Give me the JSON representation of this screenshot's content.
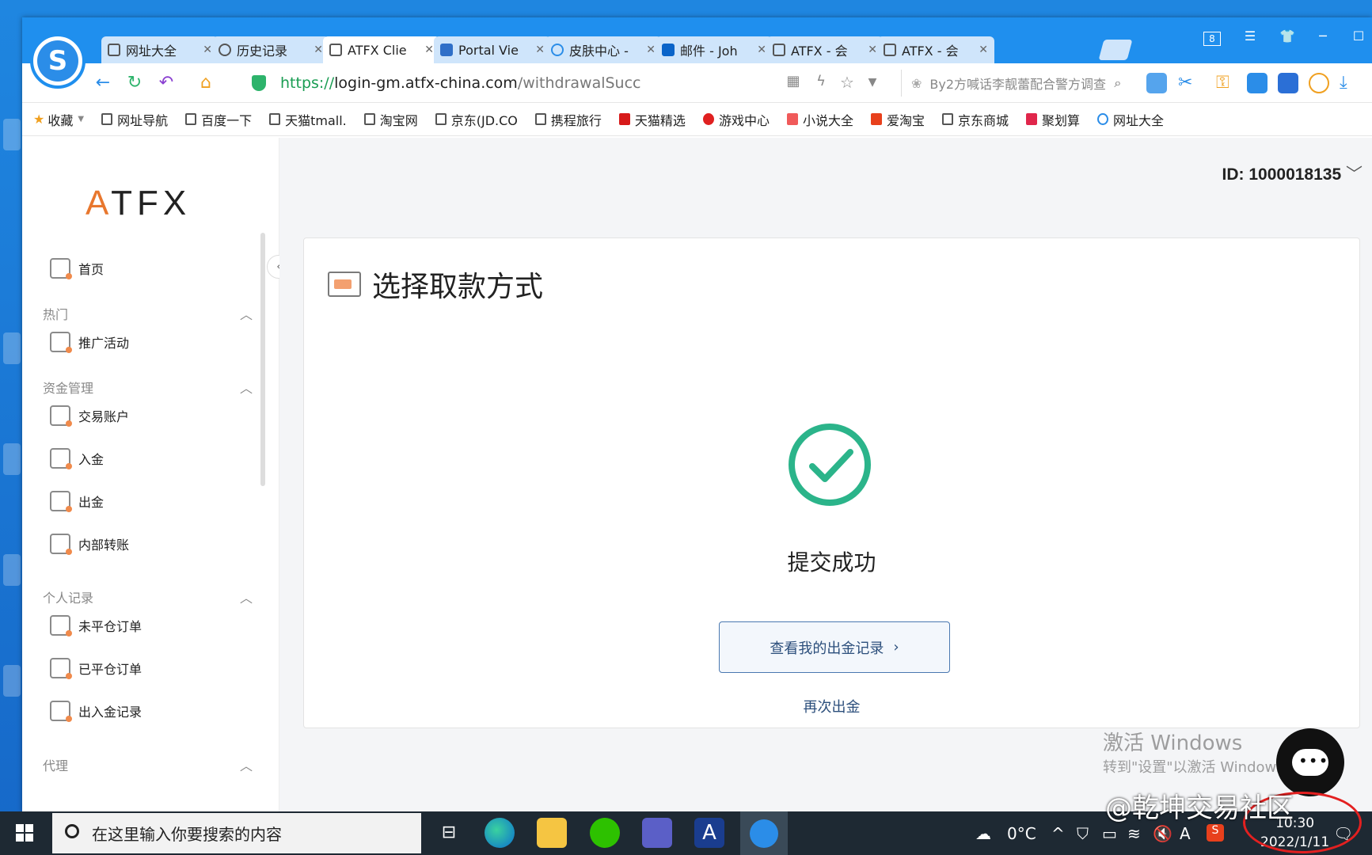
{
  "browser": {
    "tabs": [
      {
        "label": "网址大全"
      },
      {
        "label": "历史记录"
      },
      {
        "label": "ATFX Clie"
      },
      {
        "label": "Portal Vie"
      },
      {
        "label": "皮肤中心 -"
      },
      {
        "label": "邮件 - Joh"
      },
      {
        "label": "ATFX - 会"
      },
      {
        "label": "ATFX - 会"
      }
    ],
    "active_tab_index": 2,
    "tab_count_badge": "8",
    "url": {
      "https": "https://",
      "host": "login-gm.atfx-china.com",
      "path": "/withdrawalSucc"
    },
    "search_hint": "By2方喊话李靓蕾配合警方调查"
  },
  "bookmarks": [
    "收藏",
    "网址导航",
    "百度一下",
    "天猫tmall.",
    "淘宝网",
    "京东(JD.CO",
    "携程旅行",
    "天猫精选",
    "游戏中心",
    "小说大全",
    "爱淘宝",
    "京东商城",
    "聚划算",
    "网址大全"
  ],
  "sidebar": {
    "logo": {
      "a": "A",
      "rest": "TFX"
    },
    "home": "首页",
    "sections": [
      {
        "title": "热门",
        "items": [
          "推广活动"
        ]
      },
      {
        "title": "资金管理",
        "items": [
          "交易账户",
          "入金",
          "出金",
          "内部转账"
        ]
      },
      {
        "title": "个人记录",
        "items": [
          "未平仓订单",
          "已平仓订单",
          "出入金记录"
        ]
      },
      {
        "title": "代理",
        "items": []
      }
    ]
  },
  "header": {
    "account_id": "ID: 1000018135"
  },
  "main": {
    "title": "选择取款方式",
    "status": "提交成功",
    "view_button": "查看我的出金记录",
    "again_link": "再次出金"
  },
  "overlay": {
    "activate_title": "激活 Windows",
    "activate_sub": "转到\"设置\"以激活 Windows",
    "watermark": "@乾坤交易社区"
  },
  "taskbar": {
    "search_placeholder": "在这里输入你要搜索的内容",
    "weather": "0°C",
    "time": "10:30",
    "date": "2022/1/11"
  },
  "colors": {
    "accent_blue": "#1f8fee",
    "success_green": "#2bb48a",
    "brand_orange": "#e8772e"
  }
}
